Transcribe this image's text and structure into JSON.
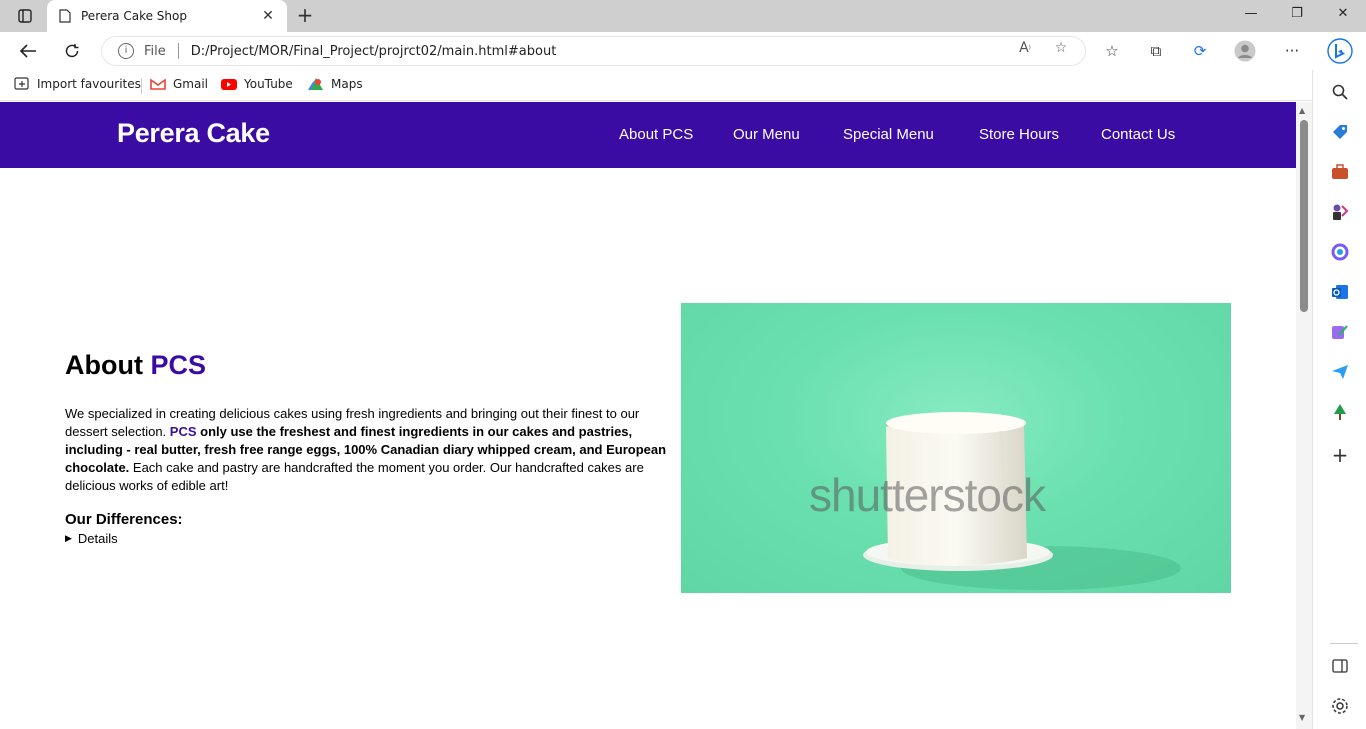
{
  "browser": {
    "tab_title": "Perera Cake Shop",
    "url_scheme_label": "File",
    "url": "D:/Project/MOR/Final_Project/projrct02/main.html#about",
    "favourites": [
      "Import favourites",
      "Gmail",
      "YouTube",
      "Maps"
    ]
  },
  "site": {
    "logo": "Perera Cake",
    "nav": [
      "About PCS",
      "Our Menu",
      "Special Menu",
      "Store Hours",
      "Contact Us"
    ],
    "brand_color": "#3a0ca3"
  },
  "about": {
    "title_plain": "About ",
    "title_accent": "PCS",
    "para_part1": "We specialized in creating delicious cakes using fresh ingredients and bringing out their finest to our dessert selection. ",
    "para_accent": "PCS",
    "para_bold": " only use the freshest and finest ingredients in our cakes and pastries, including - real butter, fresh free range eggs, 100% Canadian diary whipped cream, and European chocolate.",
    "para_part2": " Each cake and pastry are handcrafted the moment you order. Our handcrafted cakes are delicious works of edible art!",
    "differences_title": "Our Differences:",
    "details_label": "Details"
  },
  "image": {
    "watermark": "shutterstock"
  }
}
